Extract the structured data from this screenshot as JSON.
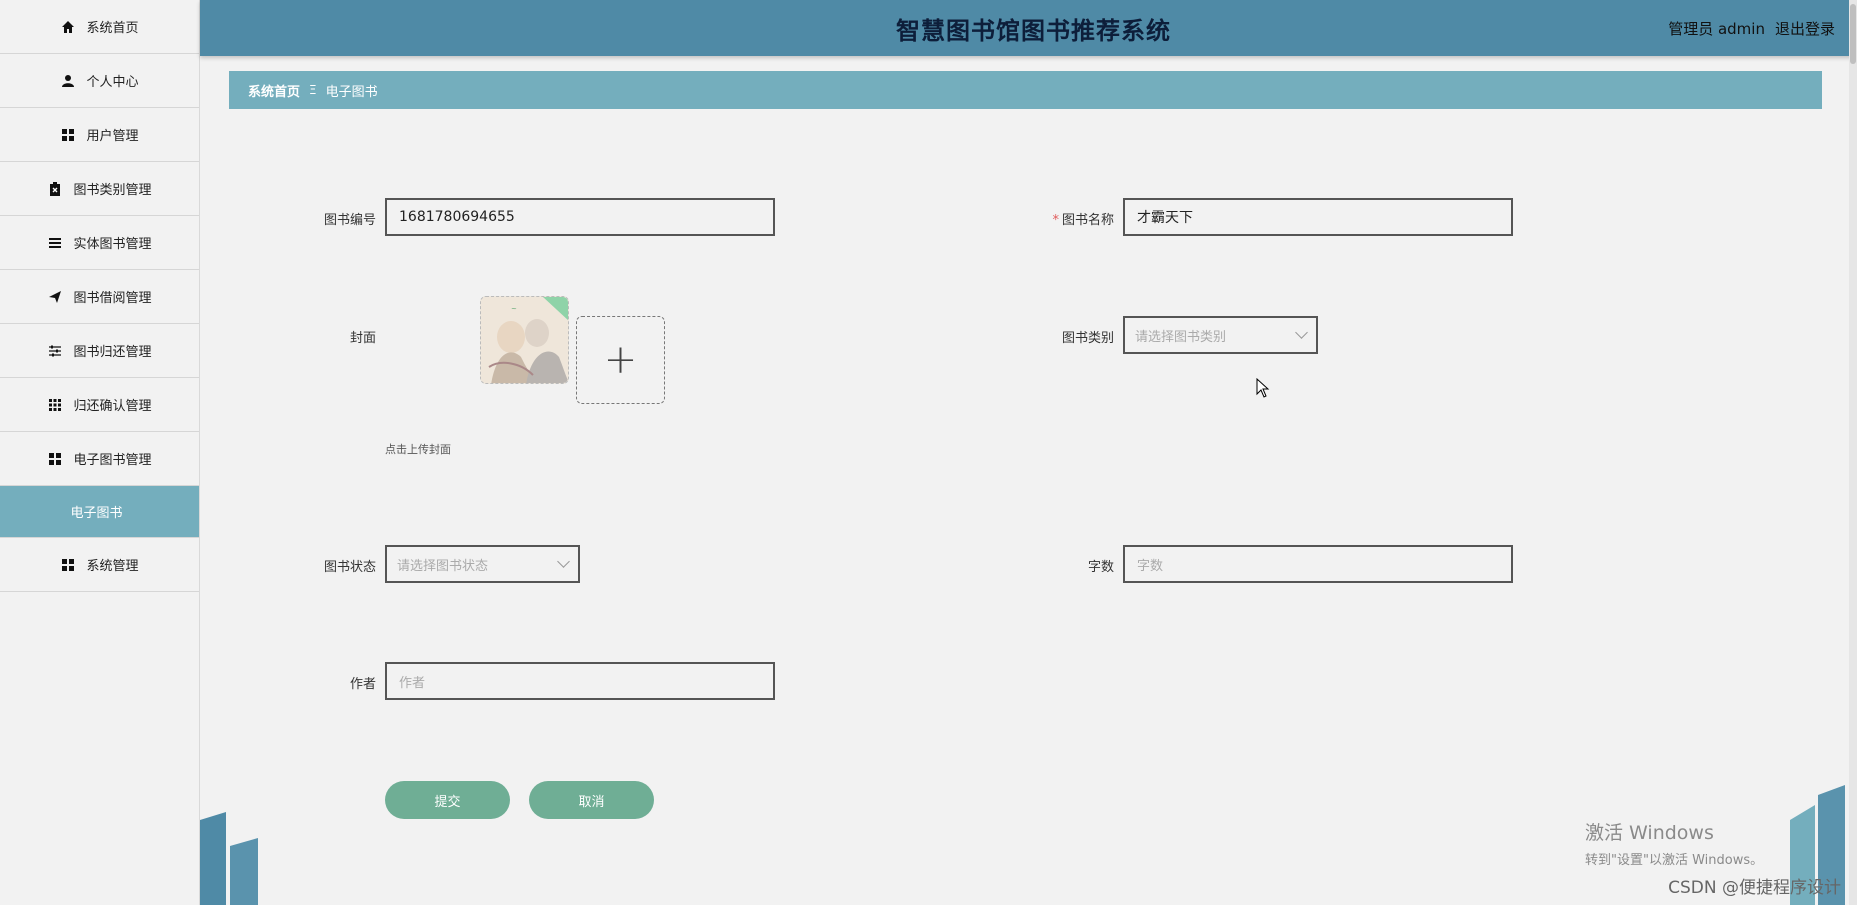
{
  "app": {
    "title": "智慧图书馆图书推荐系统",
    "user_label": "管理员 admin",
    "logout_label": "退出登录"
  },
  "sidebar": {
    "items": [
      {
        "label": "系统首页",
        "icon": "home-icon"
      },
      {
        "label": "个人中心",
        "icon": "user-icon"
      },
      {
        "label": "用户管理",
        "icon": "grid-icon"
      },
      {
        "label": "图书类别管理",
        "icon": "clipboard-icon"
      },
      {
        "label": "实体图书管理",
        "icon": "list-icon"
      },
      {
        "label": "图书借阅管理",
        "icon": "send-icon"
      },
      {
        "label": "图书归还管理",
        "icon": "sliders-icon"
      },
      {
        "label": "归还确认管理",
        "icon": "apps-icon"
      },
      {
        "label": "电子图书管理",
        "icon": "grid-icon"
      },
      {
        "label": "电子图书",
        "icon": ""
      },
      {
        "label": "系统管理",
        "icon": "grid-icon"
      }
    ]
  },
  "breadcrumb": {
    "home": "系统首页",
    "separator": "Ξ",
    "current": "电子图书"
  },
  "form": {
    "book_no_label": "图书编号",
    "book_no_value": "1681780694655",
    "book_name_label": "图书名称",
    "book_name_required": "*",
    "book_name_value": "才霸天下",
    "cover_label": "封面",
    "cover_hint": "点击上传封面",
    "upload_plus": "+",
    "category_label": "图书类别",
    "category_placeholder": "请选择图书类别",
    "status_label": "图书状态",
    "status_placeholder": "请选择图书状态",
    "word_count_label": "字数",
    "word_count_placeholder": "字数",
    "author_label": "作者",
    "author_placeholder": "作者",
    "submit_label": "提交",
    "cancel_label": "取消"
  },
  "watermark": {
    "line1": "激活 Windows",
    "line2": "转到\"设置\"以激活 Windows。",
    "csdn": "CSDN @便捷程序设计"
  },
  "colors": {
    "header": "#4f8aa6",
    "accent": "#74aebd",
    "button": "#6fae95",
    "required": "#e05a5a"
  }
}
